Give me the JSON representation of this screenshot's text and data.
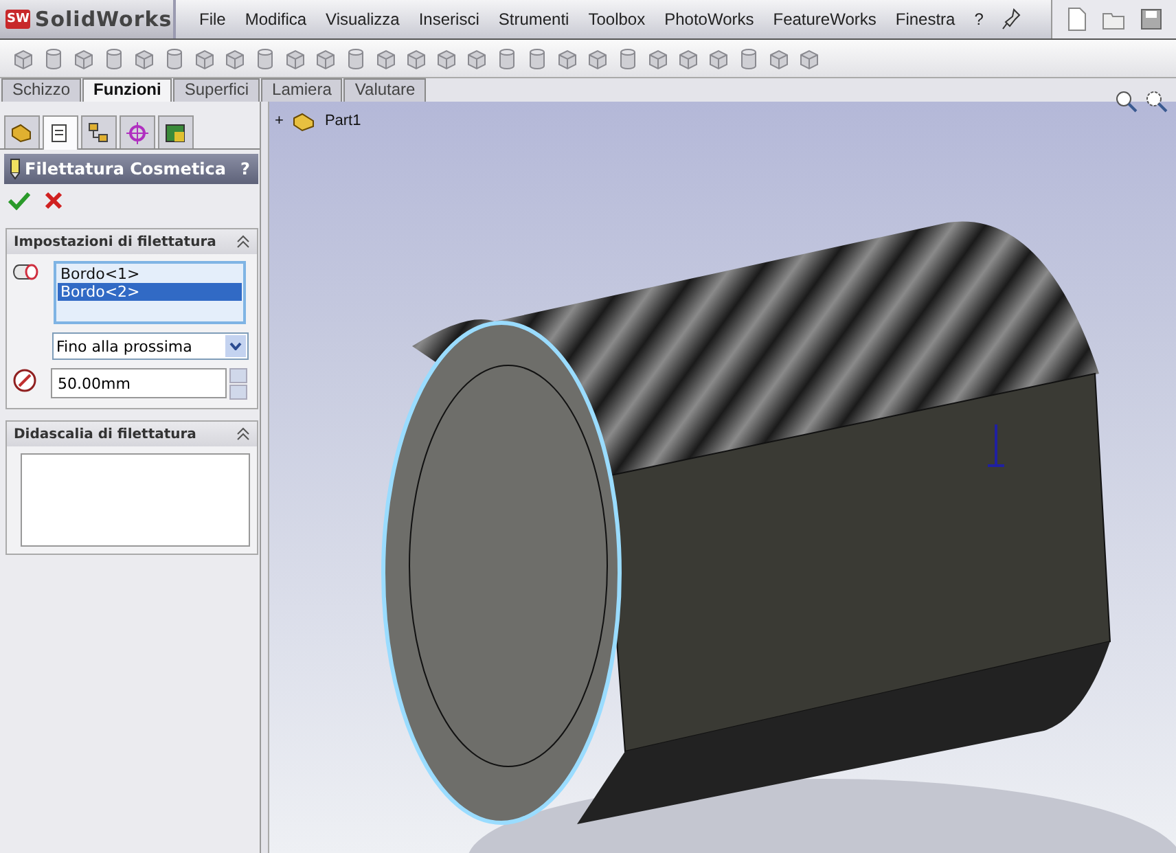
{
  "app": {
    "logo_mark": "SW",
    "name": "SolidWorks"
  },
  "menu": [
    "File",
    "Modifica",
    "Visualizza",
    "Inserisci",
    "Strumenti",
    "Toolbox",
    "PhotoWorks",
    "FeatureWorks",
    "Finestra",
    "?"
  ],
  "command_tabs": [
    {
      "label": "Schizzo",
      "selected": false
    },
    {
      "label": "Funzioni",
      "selected": true
    },
    {
      "label": "Superfici",
      "selected": false
    },
    {
      "label": "Lamiera",
      "selected": false
    },
    {
      "label": "Valutare",
      "selected": false
    }
  ],
  "panel_tabs": [
    {
      "selected": false
    },
    {
      "selected": true
    },
    {
      "selected": false
    },
    {
      "selected": false
    },
    {
      "selected": false
    }
  ],
  "property_manager": {
    "title": "Filettatura Cosmetica",
    "help": "?",
    "sections": [
      {
        "title": "Impostazioni di filettatura",
        "expanded": true,
        "edges": [
          {
            "label": "Bordo<1>",
            "selected": false
          },
          {
            "label": "Bordo<2>",
            "selected": true
          }
        ],
        "end_condition": "Fino alla prossima",
        "length": "50.00mm"
      },
      {
        "title": "Didascalia di filettatura",
        "expanded": true
      }
    ]
  },
  "tree": {
    "expander": "+",
    "part": "Part1"
  }
}
